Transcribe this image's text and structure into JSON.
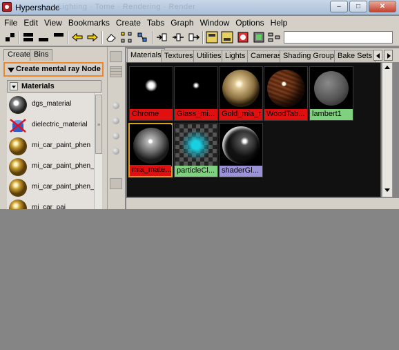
{
  "window": {
    "title": "Hypershade",
    "ghost_title": "Lighting · Tome · Rendering · Render",
    "buttons": {
      "minimize": "–",
      "maximize": "□",
      "close": "✕"
    }
  },
  "menu": [
    "File",
    "Edit",
    "View",
    "Bookmarks",
    "Create",
    "Tabs",
    "Graph",
    "Window",
    "Options",
    "Help"
  ],
  "left_panel": {
    "tabs": [
      "Create",
      "Bins"
    ],
    "create_dropdown": "Create mental ray Node",
    "section_header": "Materials",
    "nodes": [
      {
        "label": "dgs_material",
        "icon": "dgs-sphere-icon"
      },
      {
        "label": "dielectric_material",
        "icon": "dielectric-icon"
      },
      {
        "label": "mi_car_paint_phen",
        "icon": "gold-sphere-icon"
      },
      {
        "label": "mi_car_paint_phen_",
        "icon": "gold-sphere-icon"
      },
      {
        "label": "mi_car_paint_phen_",
        "icon": "gold-sphere-icon"
      },
      {
        "label": "mi_car_pai",
        "icon": "gold-sphere-icon"
      }
    ]
  },
  "work_area": {
    "tabs": [
      "Materials",
      "Textures",
      "Utilities",
      "Lights",
      "Cameras",
      "Shading Groups",
      "Bake Sets"
    ],
    "active_tab": "Materials",
    "swatches": [
      {
        "label": "Chrome",
        "label_color": "#e01010",
        "kind": "dark-highlight"
      },
      {
        "label": "Glass_mi...",
        "label_color": "#e01010",
        "kind": "dark-small-highlight"
      },
      {
        "label": "Gold_mia_r",
        "label_color": "#e01010",
        "kind": "tan-sphere"
      },
      {
        "label": "WoodTab...",
        "label_color": "#e01010",
        "kind": "wood-sphere"
      },
      {
        "label": "lambert1",
        "label_color": "#7fd07f",
        "kind": "gray-sphere"
      },
      {
        "label": "mia_mate...",
        "label_color": "#e01010",
        "kind": "gray-highlight-sphere"
      },
      {
        "label": "particleCl...",
        "label_color": "#7fd07f",
        "kind": "checker-glow"
      },
      {
        "label": "shaderGl...",
        "label_color": "#9a93d8",
        "kind": "glossy-black-sphere"
      }
    ]
  }
}
